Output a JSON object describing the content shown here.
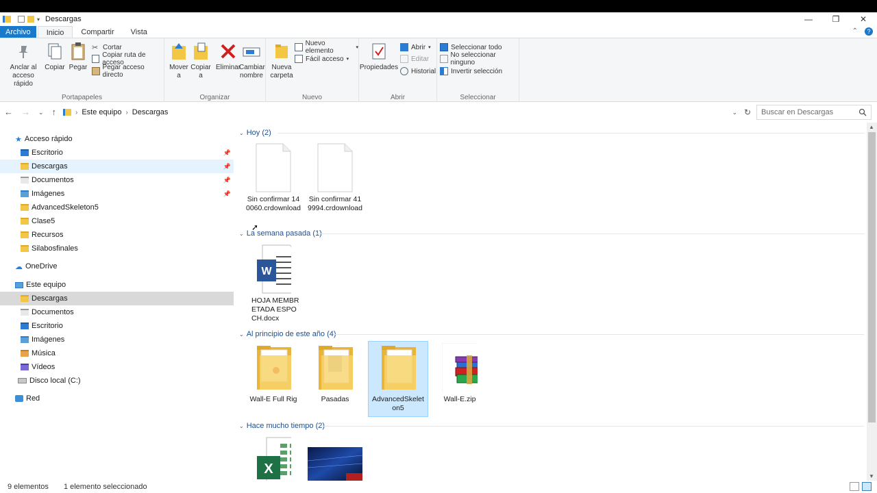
{
  "window": {
    "title": "Descargas",
    "minimize": "—",
    "maximize": "❐",
    "close": "✕"
  },
  "tabs": [
    {
      "label": "Archivo"
    },
    {
      "label": "Inicio"
    },
    {
      "label": "Compartir"
    },
    {
      "label": "Vista"
    }
  ],
  "ribbon": {
    "portapapeles": {
      "label": "Portapapeles",
      "anclar": "Anclar al acceso rápido",
      "copiar": "Copiar",
      "pegar": "Pegar",
      "cortar": "Cortar",
      "copiar_ruta": "Copiar ruta de acceso",
      "pegar_acceso": "Pegar acceso directo"
    },
    "organizar": {
      "label": "Organizar",
      "mover": "Mover a",
      "copiar": "Copiar a",
      "eliminar": "Eliminar",
      "cambiar": "Cambiar nombre"
    },
    "nuevo": {
      "label": "Nuevo",
      "carpeta": "Nueva carpeta",
      "elemento": "Nuevo elemento",
      "facil": "Fácil acceso"
    },
    "abrir": {
      "label": "Abrir",
      "propiedades": "Propiedades",
      "abrir": "Abrir",
      "editar": "Editar",
      "historial": "Historial"
    },
    "seleccionar": {
      "label": "Seleccionar",
      "todo": "Seleccionar todo",
      "ninguno": "No seleccionar ninguno",
      "invertir": "Invertir selección"
    }
  },
  "address": {
    "crumbs": [
      "Este equipo",
      "Descargas"
    ],
    "search_placeholder": "Buscar en Descargas"
  },
  "nav": {
    "quick_access": "Acceso rápido",
    "quick_items": [
      "Escritorio",
      "Descargas",
      "Documentos",
      "Imágenes",
      "AdvancedSkeleton5",
      "Clase5",
      "Recursos",
      "Silabosfinales"
    ],
    "onedrive": "OneDrive",
    "this_pc": "Este equipo",
    "pc_items": [
      "Descargas",
      "Documentos",
      "Escritorio",
      "Imágenes",
      "Música",
      "Vídeos",
      "Disco local (C:)"
    ],
    "network": "Red"
  },
  "groups": [
    {
      "title": "Hoy (2)"
    },
    {
      "title": "La semana pasada (1)"
    },
    {
      "title": "Al principio de este año (4)"
    },
    {
      "title": "Hace mucho tiempo (2)"
    }
  ],
  "files": {
    "f1": "Sin confirmar 140060.crdownload",
    "f2": "Sin confirmar 419994.crdownload",
    "f3": "HOJA MEMBRETADA ESPOCH.docx",
    "f4": "Wall-E Full Rig",
    "f5": "Pasadas",
    "f6": "AdvancedSkeleton5",
    "f7": "Wall-E.zip"
  },
  "status": {
    "count": "9 elementos",
    "selected": "1 elemento seleccionado"
  },
  "colors": {
    "accent": "#1979ca",
    "folder": "#f3c646",
    "selection": "#cce8ff"
  }
}
